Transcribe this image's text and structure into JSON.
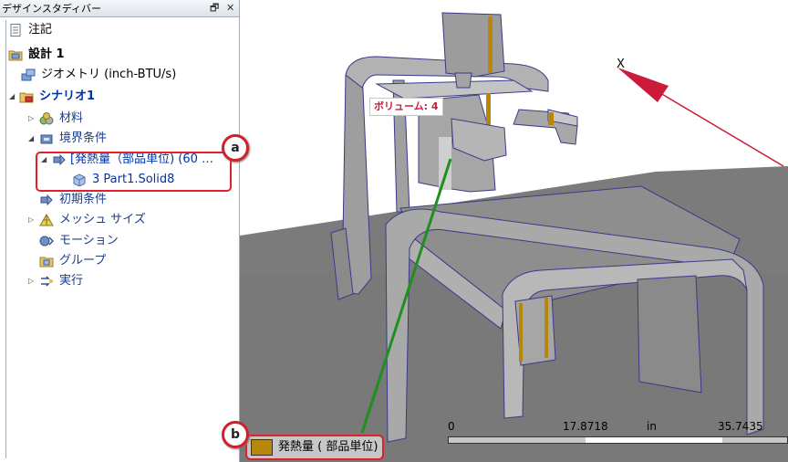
{
  "panel": {
    "title": "デザインスタディバー",
    "pin_glyph": "🗗",
    "close_glyph": "✕"
  },
  "tree": {
    "notes": "注記",
    "design": "設計 1",
    "geometry": "ジオメトリ (inch-BTU/s)",
    "scenario": "シナリオ1",
    "materials": "材料",
    "boundary": "境界条件",
    "heat_gen": "[発熱量（部品単位) (60 …",
    "part": "3 Part1.Solid8",
    "initial": "初期条件",
    "mesh": "メッシュ サイズ",
    "motion": "モーション",
    "groups": "グループ",
    "run": "実行"
  },
  "viewport": {
    "volume_label": "ボリューム: 4",
    "axis_label": "X",
    "legend_label": "発熱量 ( 部品単位)",
    "legend_color": "#b8860b",
    "scale": {
      "start": "0",
      "mid": "17.8718",
      "unit": "in",
      "end": "35.7435"
    }
  },
  "callouts": {
    "a": "a",
    "b": "b"
  },
  "colors": {
    "accent_red": "#e0202a",
    "tree_blue": "#0033a8",
    "leader_green": "#1f8f1f",
    "label_red": "#cc1b3a"
  }
}
